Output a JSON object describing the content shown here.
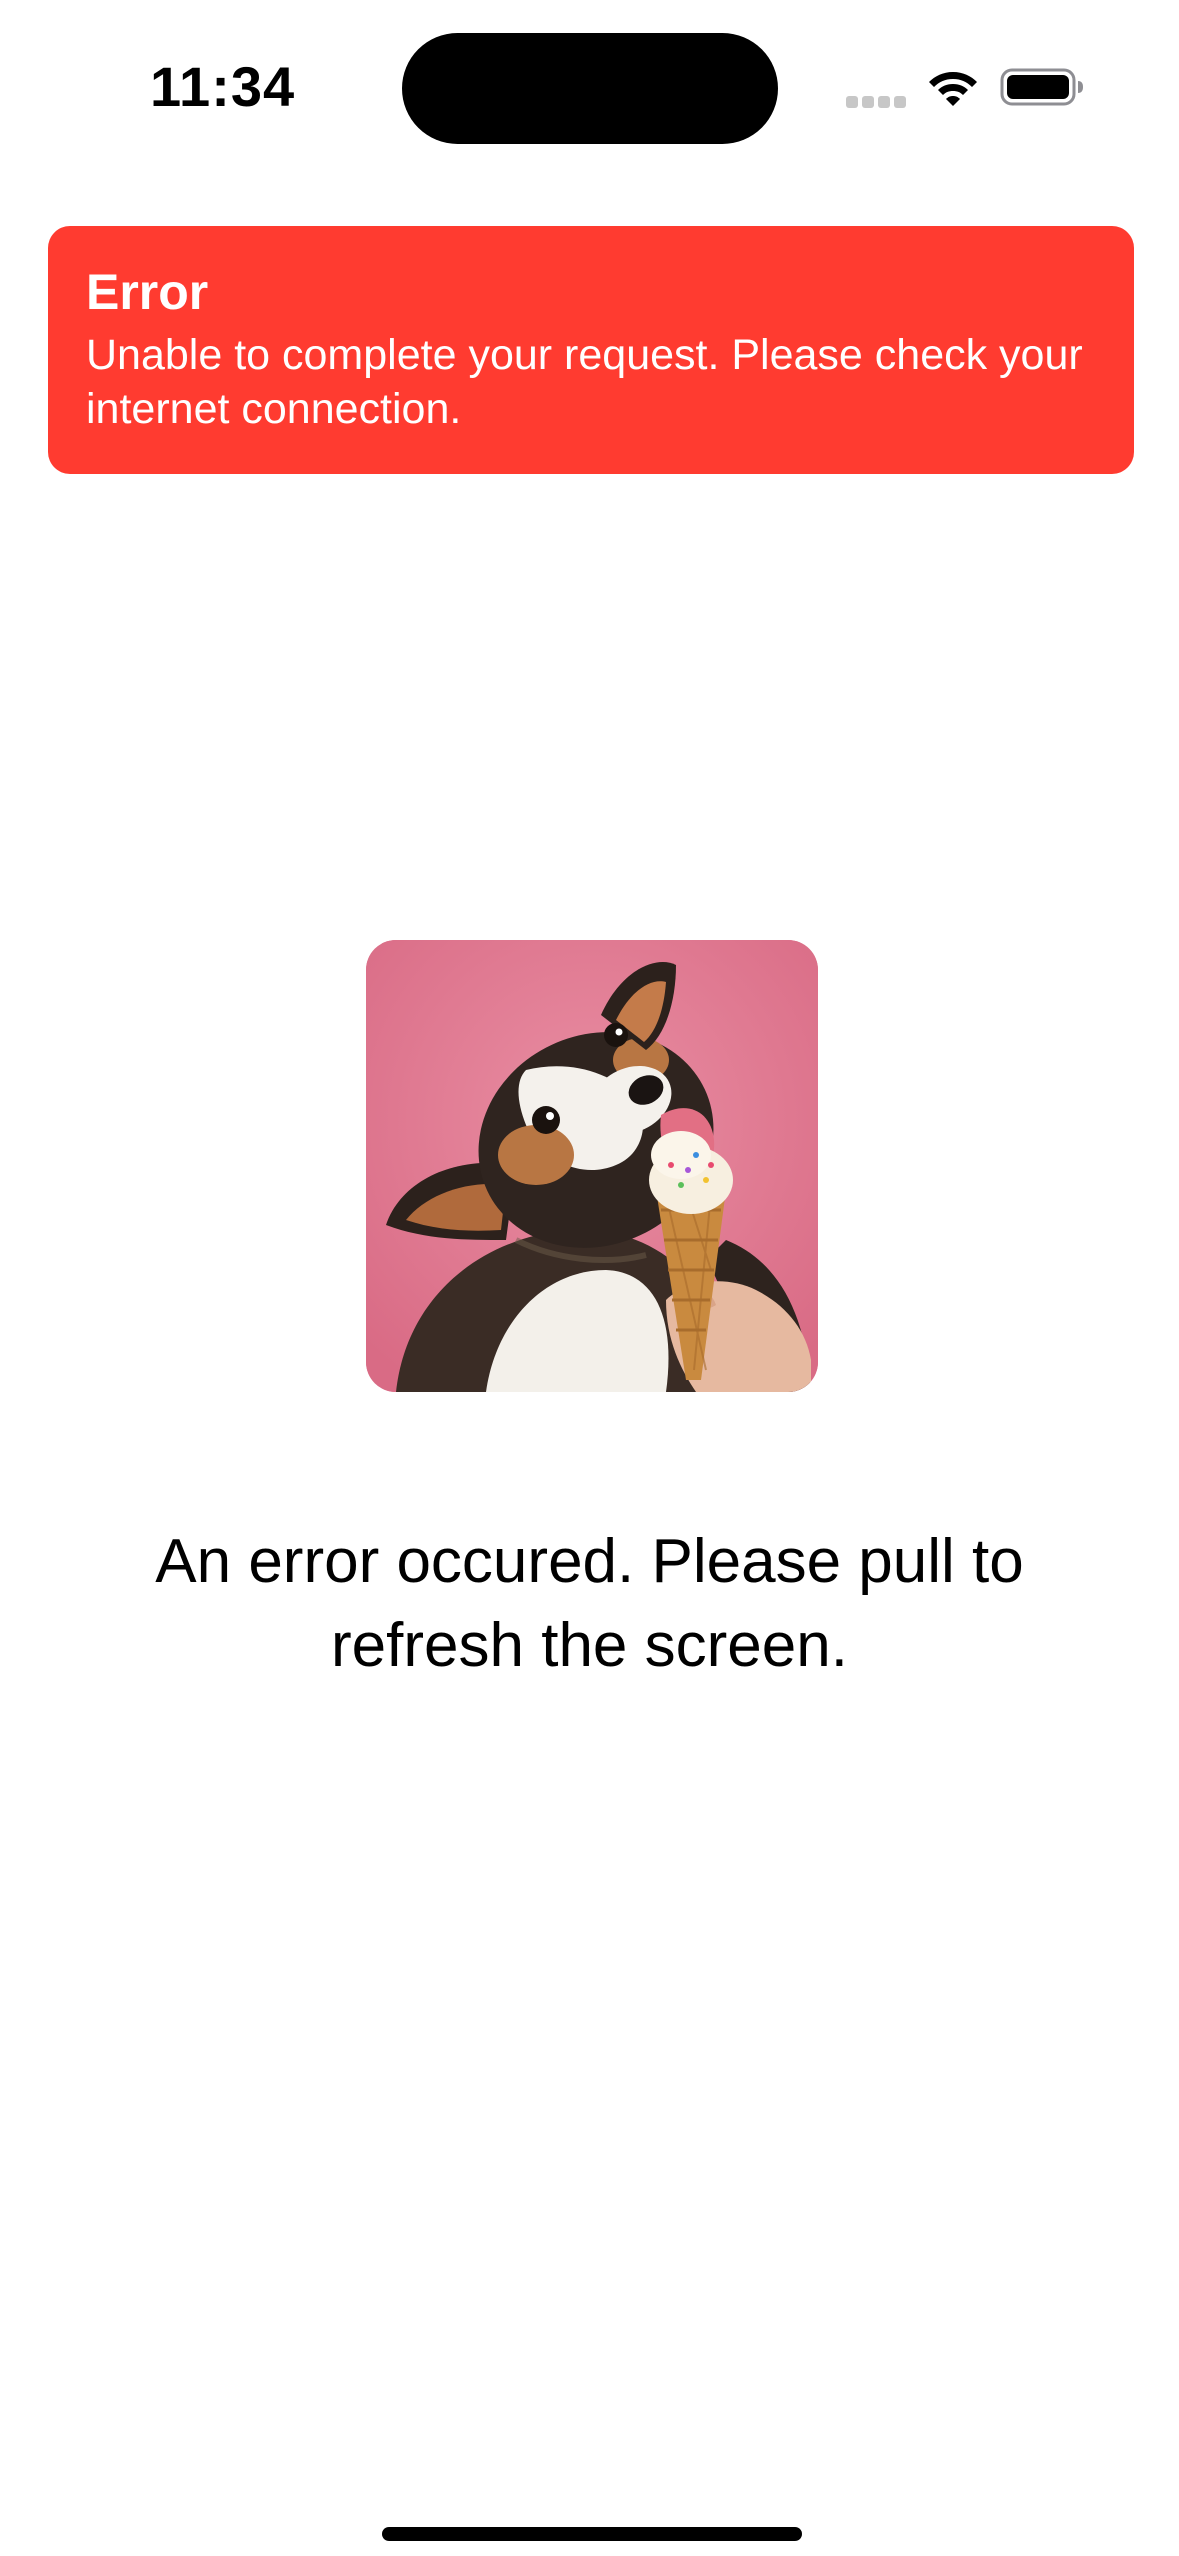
{
  "status_bar": {
    "time": "11:34",
    "icons": [
      "cellular-signal-icon",
      "wifi-icon",
      "battery-icon"
    ]
  },
  "error_banner": {
    "title": "Error",
    "message": "Unable to complete your request. Please check your internet connection.",
    "background_color": "#ff3b30",
    "text_color": "#ffffff"
  },
  "main": {
    "image": "dog-eating-ice-cream-illustration",
    "message": "An error occured. Please pull to refresh the screen."
  },
  "home_indicator": "home-indicator"
}
